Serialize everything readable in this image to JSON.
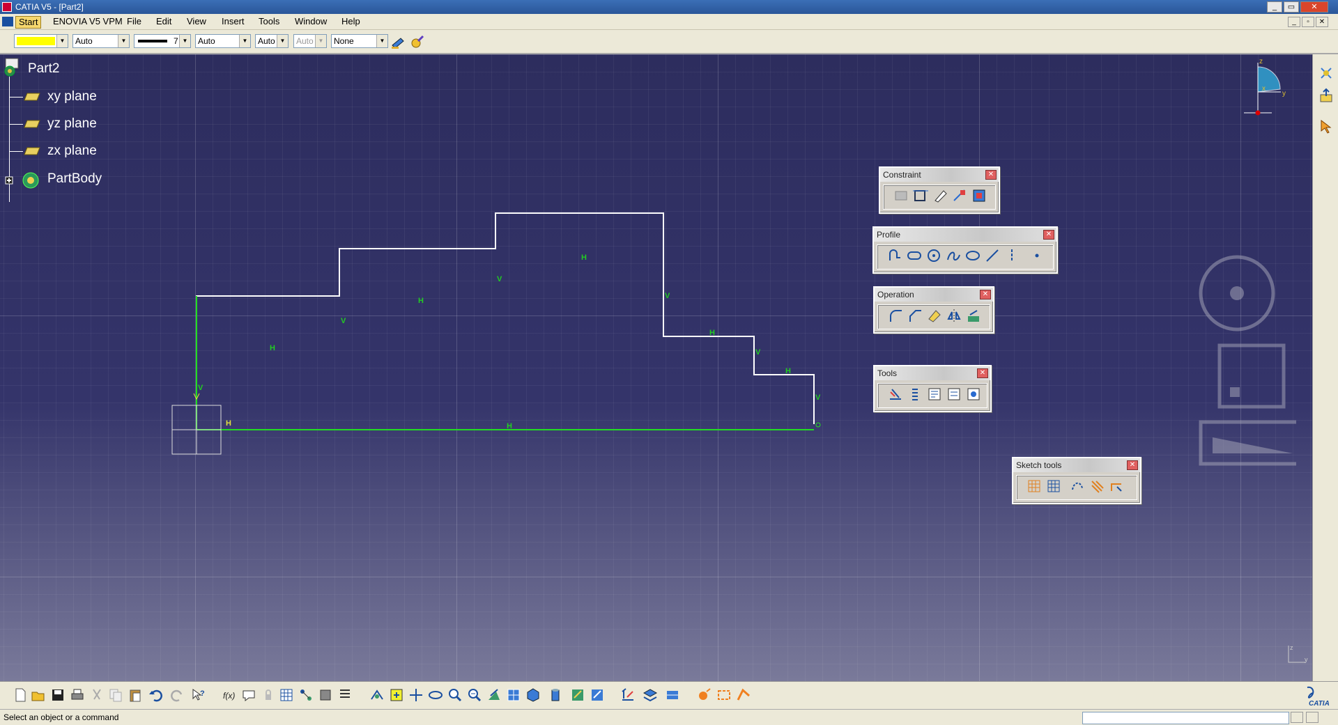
{
  "window": {
    "title": "CATIA V5 - [Part2]"
  },
  "menu": {
    "items": [
      "Start",
      "ENOVIA V5 VPM",
      "File",
      "Edit",
      "View",
      "Insert",
      "Tools",
      "Window",
      "Help"
    ]
  },
  "graphic_properties": {
    "color_swatch": "#ffff00",
    "transparency": "Auto",
    "line_thickness": "7",
    "line_type": "Auto",
    "point_type": "Auto",
    "layer": "Auto",
    "filter": "None"
  },
  "tree": {
    "root": "Part2",
    "items": [
      "xy plane",
      "yz plane",
      "zx plane"
    ],
    "body": "PartBody"
  },
  "compass": {
    "z": "z",
    "x": "x",
    "y": "y"
  },
  "toolbars": {
    "constraint": "Constraint",
    "profile": "Profile",
    "operation": "Operation",
    "tools": "Tools",
    "sketch_tools": "Sketch tools"
  },
  "sketch": {
    "h": "H",
    "v": "V"
  },
  "axis_corner": {
    "z": "z",
    "y": "y"
  },
  "status": {
    "message": "Select an object or a command"
  },
  "brand": {
    "logo": "CATIA"
  }
}
